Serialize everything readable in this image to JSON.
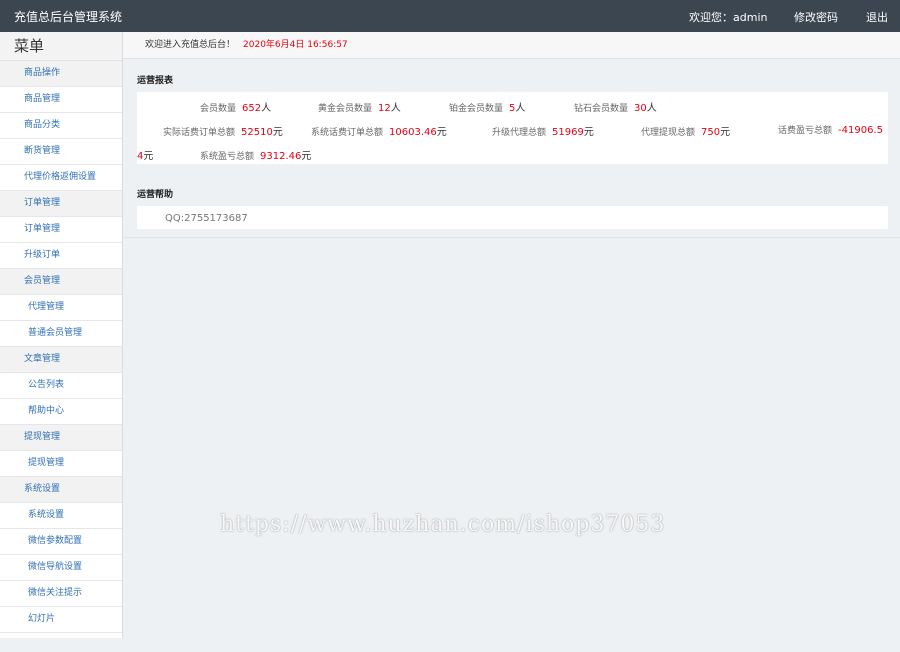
{
  "app": {
    "title": "充值总后台管理系统",
    "welcome_user": "欢迎您：admin",
    "change_password": "修改密码",
    "logout": "退出"
  },
  "sidebar": {
    "title": "菜单",
    "items": [
      {
        "label": "商品操作",
        "type": "group"
      },
      {
        "label": "商品管理",
        "type": "item"
      },
      {
        "label": "商品分类",
        "type": "item"
      },
      {
        "label": "断货管理",
        "type": "item"
      },
      {
        "label": "代理价格返佣设置",
        "type": "item"
      },
      {
        "label": "订单管理",
        "type": "group"
      },
      {
        "label": "订单管理",
        "type": "item"
      },
      {
        "label": "升级订单",
        "type": "item"
      },
      {
        "label": "会员管理",
        "type": "group"
      },
      {
        "label": "代理管理",
        "type": "sub"
      },
      {
        "label": "普通会员管理",
        "type": "sub"
      },
      {
        "label": "文章管理",
        "type": "group"
      },
      {
        "label": "公告列表",
        "type": "sub"
      },
      {
        "label": "帮助中心",
        "type": "sub"
      },
      {
        "label": "提现管理",
        "type": "group"
      },
      {
        "label": "提现管理",
        "type": "sub"
      },
      {
        "label": "系统设置",
        "type": "group"
      },
      {
        "label": "系统设置",
        "type": "sub"
      },
      {
        "label": "微信参数配置",
        "type": "sub"
      },
      {
        "label": "微信导航设置",
        "type": "sub"
      },
      {
        "label": "微信关注提示",
        "type": "sub"
      },
      {
        "label": "幻灯片",
        "type": "sub"
      }
    ]
  },
  "welcome": {
    "text": "欢迎进入充值总后台！",
    "datetime": "2020年6月4日 16:56:57"
  },
  "report": {
    "title": "运营报表",
    "members": {
      "label": "会员数量",
      "value": "652",
      "unit": "人"
    },
    "gold_members": {
      "label": "黄金会员数量",
      "value": "12",
      "unit": "人"
    },
    "platinum_members": {
      "label": "铂金会员数量",
      "value": "5",
      "unit": "人"
    },
    "diamond_members": {
      "label": "钻石会员数量",
      "value": "30",
      "unit": "人"
    },
    "actual_recharge_total": {
      "label": "实际话费订单总额",
      "value": "52510",
      "unit": "元"
    },
    "system_recharge_total": {
      "label": "系统话费订单总额",
      "value": "10603.46",
      "unit": "元"
    },
    "upgrade_agent_total": {
      "label": "升级代理总额",
      "value": "51969",
      "unit": "元"
    },
    "agent_withdraw_total": {
      "label": "代理提现总额",
      "value": "750",
      "unit": "元"
    },
    "phone_profit_total": {
      "label": "话费盈亏总额",
      "value_a": "-41906.5",
      "value_b": "4",
      "unit": "元"
    },
    "system_profit_total": {
      "label": "系统盈亏总额",
      "value": "9312.46",
      "unit": "元"
    }
  },
  "help": {
    "title": "运营帮助",
    "qq": "QQ:2755173687"
  },
  "watermark": "https://www.huzhan.com/ishop37053"
}
